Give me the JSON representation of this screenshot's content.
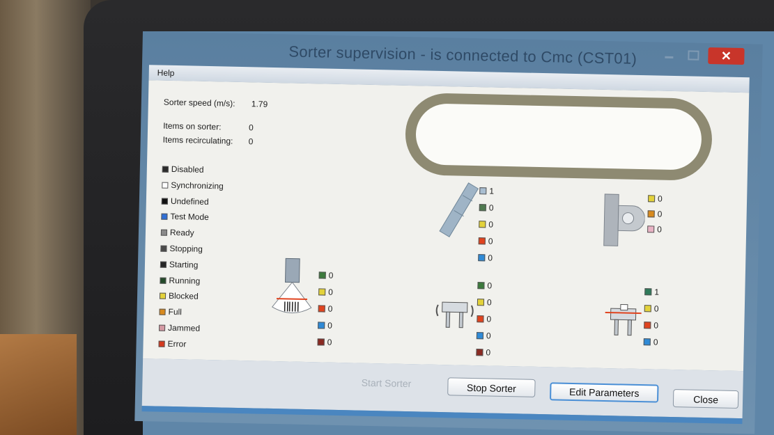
{
  "window": {
    "title": "Sorter supervision - is connected to Cmc (CST01)",
    "close_glyph": "✕"
  },
  "menu": {
    "help": "Help"
  },
  "stats": {
    "speed_label": "Sorter speed (m/s):",
    "speed_value": "1.79",
    "items_label": "Items on sorter:",
    "items_value": "0",
    "recirc_label": "Items recirculating:",
    "recirc_value": "0"
  },
  "legend": [
    {
      "label": "Disabled",
      "color": "#2b2b2b"
    },
    {
      "label": "Synchronizing",
      "color": "#ffffff"
    },
    {
      "label": "Undefined",
      "color": "#111111"
    },
    {
      "label": "Test Mode",
      "color": "#2f6fd6"
    },
    {
      "label": "Ready",
      "color": "#8a8a8a"
    },
    {
      "label": "Stopping",
      "color": "#4a4a4a"
    },
    {
      "label": "Starting",
      "color": "#262626"
    },
    {
      "label": "Running",
      "color": "#244a2a"
    },
    {
      "label": "Blocked",
      "color": "#e3d23a"
    },
    {
      "label": "Full",
      "color": "#d88a1e"
    },
    {
      "label": "Jammed",
      "color": "#d49aa3"
    },
    {
      "label": "Error",
      "color": "#d43a1e"
    }
  ],
  "counters": {
    "scanner": [
      {
        "value": "0",
        "color": "#3c7a3c"
      },
      {
        "value": "0",
        "color": "#e3d23a"
      },
      {
        "value": "0",
        "color": "#e0431e"
      },
      {
        "value": "0",
        "color": "#2f8ad6"
      },
      {
        "value": "0",
        "color": "#8a2a22"
      }
    ],
    "chute": [
      {
        "value": "1",
        "color": "#a9bed1"
      },
      {
        "value": "0",
        "color": "#4f7a4f"
      },
      {
        "value": "0",
        "color": "#e3d23a"
      },
      {
        "value": "0",
        "color": "#e0431e"
      },
      {
        "value": "0",
        "color": "#2f8ad6"
      }
    ],
    "induction": [
      {
        "value": "0",
        "color": "#3c7a3c"
      },
      {
        "value": "0",
        "color": "#e3d23a"
      },
      {
        "value": "0",
        "color": "#e0431e"
      },
      {
        "value": "0",
        "color": "#2f8ad6"
      },
      {
        "value": "0",
        "color": "#8a2a22"
      }
    ],
    "discharge": [
      {
        "value": "0",
        "color": "#e3d23a"
      },
      {
        "value": "0",
        "color": "#d88a1e"
      },
      {
        "value": "0",
        "color": "#e8b3c4"
      }
    ],
    "station": [
      {
        "value": "1",
        "color": "#2f7a5a"
      },
      {
        "value": "0",
        "color": "#e3d23a"
      },
      {
        "value": "0",
        "color": "#e0431e"
      },
      {
        "value": "0",
        "color": "#2f8ad6"
      }
    ]
  },
  "buttons": {
    "start": "Start Sorter",
    "stop": "Stop Sorter",
    "edit": "Edit Parameters",
    "close": "Close"
  }
}
